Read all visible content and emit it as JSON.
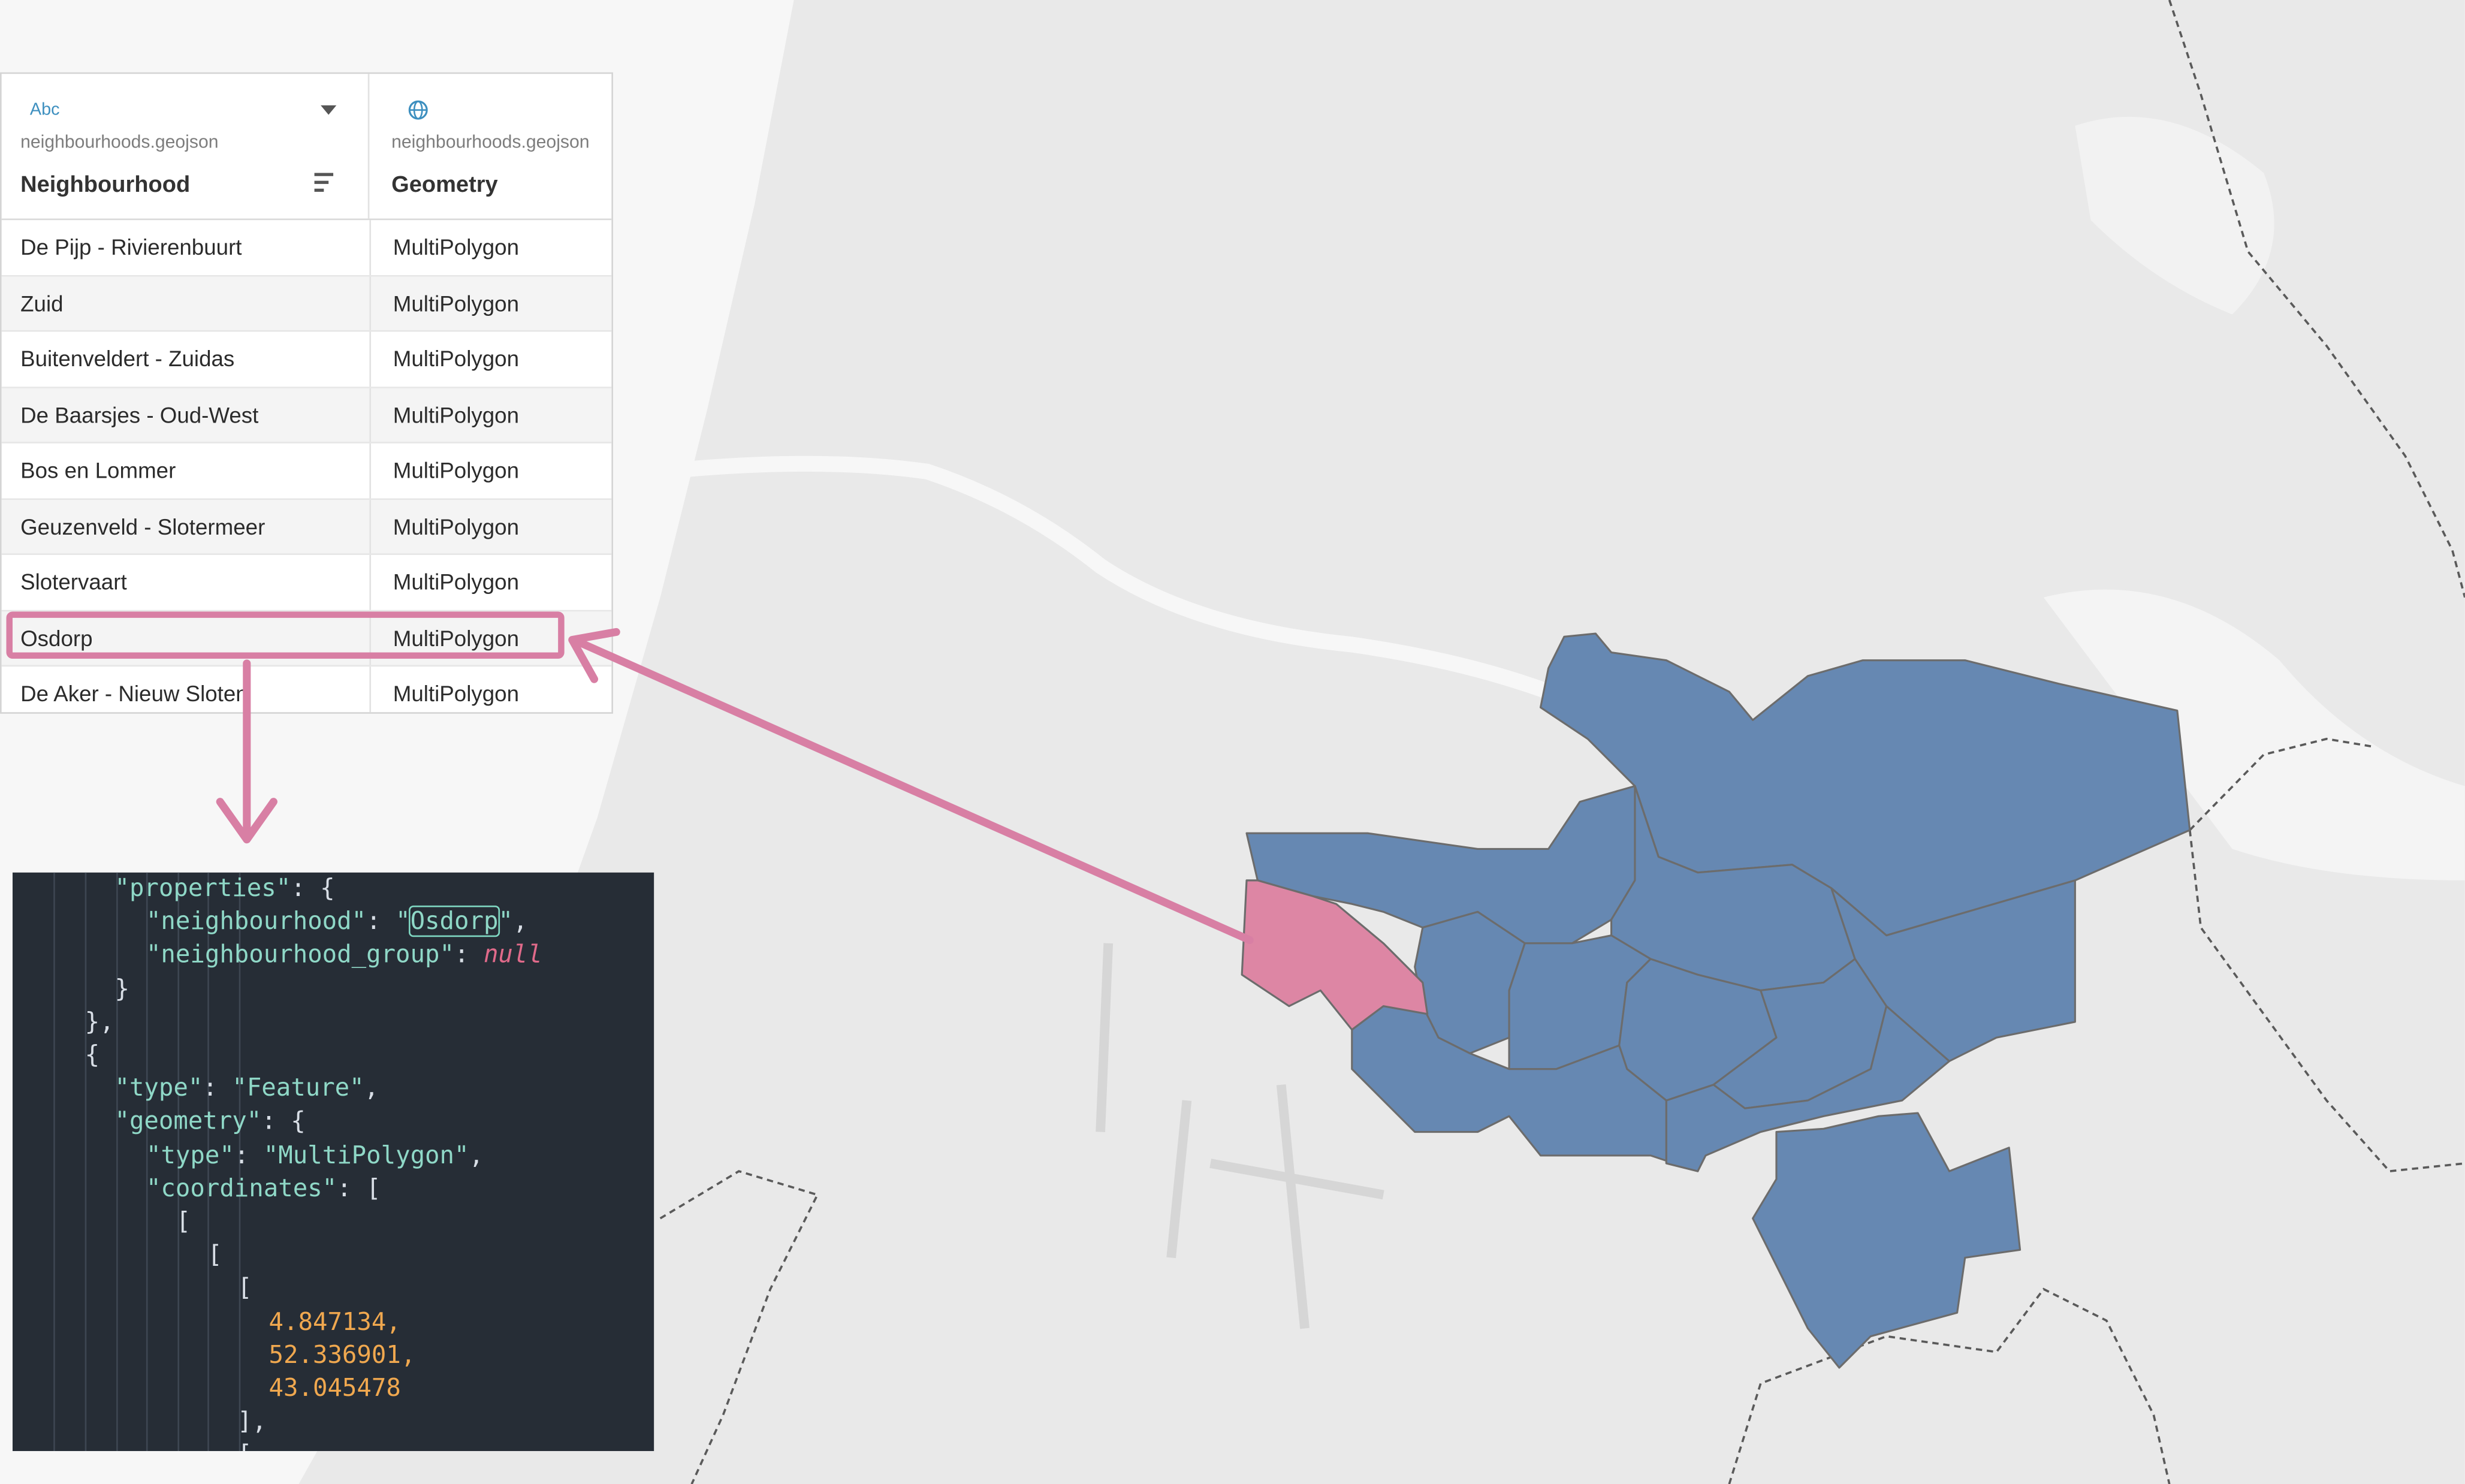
{
  "map": {
    "colors": {
      "background": "#f7f7f7",
      "land": "#e9e9e9",
      "neighbourhood": "#6688b2",
      "selected": "#dd86a4",
      "border_line": "#6c6c6c"
    },
    "selected_neighbourhood": "Osdorp"
  },
  "table": {
    "columns": [
      {
        "type_icon": "Abc",
        "source": "neighbourhoods.geojson",
        "name": "Neighbourhood"
      },
      {
        "type_icon": "globe-icon",
        "source": "neighbourhoods.geojson",
        "name": "Geometry"
      }
    ],
    "rows": [
      {
        "neighbourhood": "De Pijp - Rivierenbuurt",
        "geometry": "MultiPolygon"
      },
      {
        "neighbourhood": "Zuid",
        "geometry": "MultiPolygon"
      },
      {
        "neighbourhood": "Buitenveldert - Zuidas",
        "geometry": "MultiPolygon"
      },
      {
        "neighbourhood": "De Baarsjes - Oud-West",
        "geometry": "MultiPolygon"
      },
      {
        "neighbourhood": "Bos en Lommer",
        "geometry": "MultiPolygon"
      },
      {
        "neighbourhood": "Geuzenveld - Slotermeer",
        "geometry": "MultiPolygon"
      },
      {
        "neighbourhood": "Slotervaart",
        "geometry": "MultiPolygon"
      },
      {
        "neighbourhood": "Osdorp",
        "geometry": "MultiPolygon"
      },
      {
        "neighbourhood": "De Aker - Nieuw Sloten",
        "geometry": "MultiPolygon"
      }
    ]
  },
  "code": {
    "properties_key": "\"properties\"",
    "neighbourhood_key": "\"neighbourhood\"",
    "neighbourhood_val": "Osdorp",
    "group_key": "\"neighbourhood_group\"",
    "null_val": "null",
    "type_key": "\"type\"",
    "feature_val": "\"Feature\"",
    "geometry_key": "\"geometry\"",
    "type_key2": "\"type\"",
    "multipolygon_val": "\"MultiPolygon\"",
    "coordinates_key": "\"coordinates\"",
    "coords": [
      "4.847134,",
      "52.336901,",
      "43.045478"
    ]
  }
}
